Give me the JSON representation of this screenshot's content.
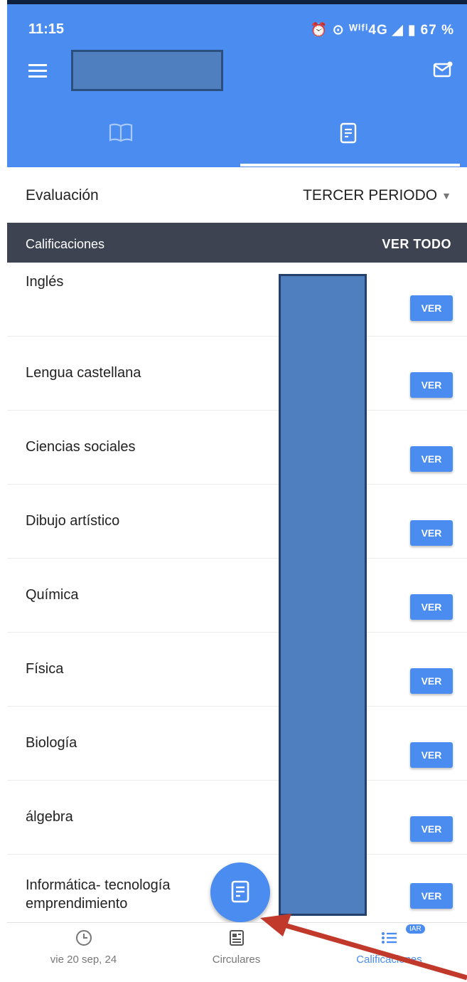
{
  "status_bar": {
    "time": "11:15",
    "icons_text": "⏰ ⊙ ᵂⁱᶠⁱ4G ◢ ▮ 67 %",
    "battery": "67 %"
  },
  "header": {
    "menu_icon": "menu-icon",
    "mail_icon": "mail-notification-icon"
  },
  "tabs": [
    {
      "icon": "book-open-icon",
      "active": false
    },
    {
      "icon": "document-icon",
      "active": true
    }
  ],
  "evaluation": {
    "label": "Evaluación",
    "selected": "TERCER PERIODO"
  },
  "section": {
    "title": "Calificaciones",
    "action": "VER TODO"
  },
  "subjects": [
    {
      "name": "Inglés",
      "button": "VER"
    },
    {
      "name": "Lengua castellana",
      "button": "VER"
    },
    {
      "name": "Ciencias sociales",
      "button": "VER"
    },
    {
      "name": "Dibujo artístico",
      "button": "VER"
    },
    {
      "name": "Química",
      "button": "VER"
    },
    {
      "name": "Física",
      "button": "VER"
    },
    {
      "name": "Biología",
      "button": "VER"
    },
    {
      "name": "álgebra",
      "button": "VER"
    },
    {
      "name": "Informática- tecnología emprendimiento",
      "button": "VER"
    }
  ],
  "bottom_nav": [
    {
      "label": "vie 20 sep, 24",
      "icon": "clock-icon"
    },
    {
      "label": "Circulares",
      "icon": "newspaper-icon"
    },
    {
      "label": "Calificaciones",
      "icon": "list-icon",
      "badge": "IAR"
    }
  ],
  "colors": {
    "primary": "#4a8cf0",
    "section_bar": "#3d4350",
    "redaction": "#4f7fbe",
    "arrow": "#c0392b"
  }
}
